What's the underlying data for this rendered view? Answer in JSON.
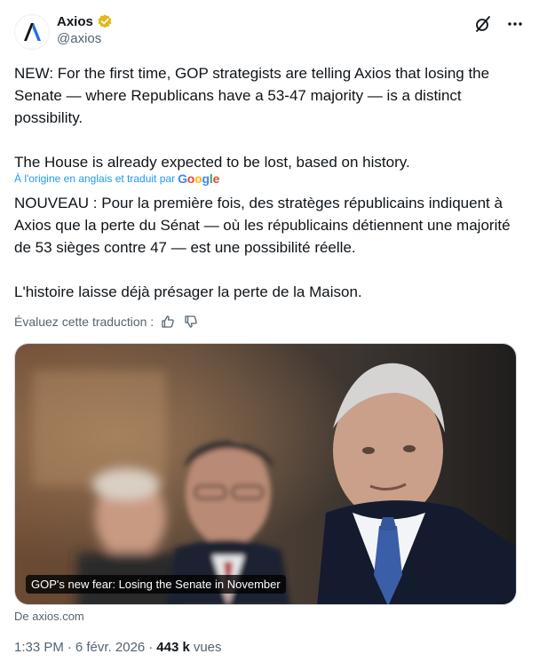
{
  "account": {
    "display_name": "Axios",
    "handle": "@axios",
    "verified_color": "#E2B719",
    "logo_glyph": "A"
  },
  "header_actions": [
    "grok-icon",
    "more-icon"
  ],
  "tweet": {
    "paragraph1": "NEW: For the first time, GOP strategists are telling Axios that losing the Senate — where Republicans have a 53-47 majority — is a distinct possibility.",
    "paragraph2": "The House is already expected to be lost, based on history."
  },
  "translation": {
    "note": "À l'origine en anglais et traduit par",
    "provider": "Google",
    "paragraph1": "NOUVEAU : Pour la première fois, des stratèges républicains indiquent à Axios que la perte du Sénat — où les républicains détiennent une majorité de 53 sièges contre 47 — est une possibilité réelle.",
    "paragraph2": "L'histoire laisse déjà présager la perte de la Maison.",
    "rate_label": "Évaluez cette traduction :"
  },
  "media": {
    "caption": "GOP's new fear: Losing the Senate in November",
    "source": "De axios.com"
  },
  "meta": {
    "time": "1:33 PM",
    "separator": "·",
    "date": "6 févr. 2026",
    "views_count": "443 k",
    "views_label": "vues"
  },
  "colors": {
    "accent": "#1d9bf0",
    "text": "#0f1419",
    "secondary": "#536471"
  }
}
